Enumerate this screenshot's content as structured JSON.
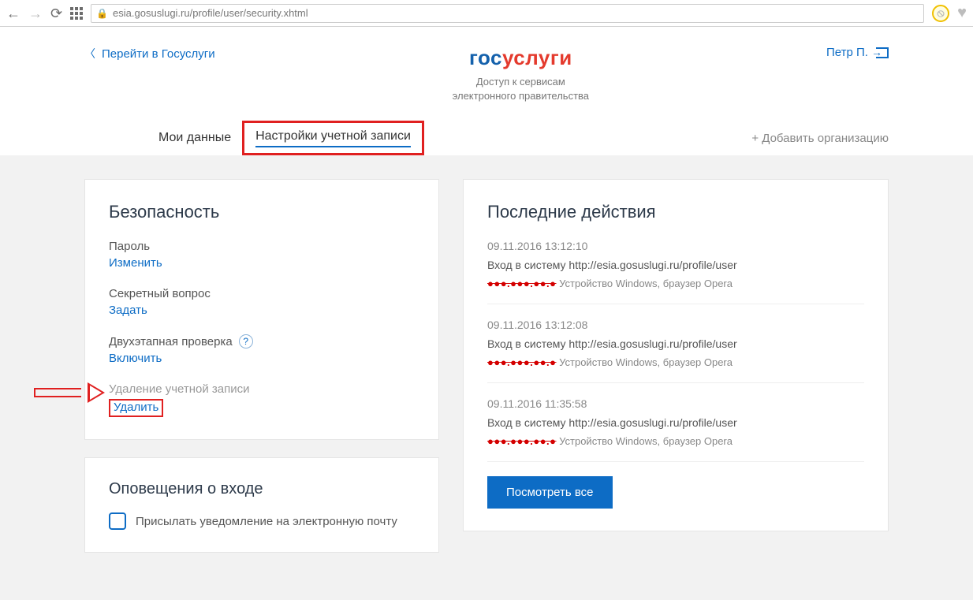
{
  "browser": {
    "url": "esia.gosuslugi.ru/profile/user/security.xhtml"
  },
  "header": {
    "back": "Перейти в Госуслуги",
    "brand_part1": "гос",
    "brand_part2": "услуги",
    "subtitle_l1": "Доступ к сервисам",
    "subtitle_l2": "электронного правительства",
    "user_name": "Петр П."
  },
  "tabs": {
    "t1": "Мои данные",
    "t2": "Настройки учетной записи",
    "add": "Добавить организацию"
  },
  "security": {
    "title": "Безопасность",
    "password_label": "Пароль",
    "password_link": "Изменить",
    "secret_label": "Секретный вопрос",
    "secret_link": "Задать",
    "twofa_label": "Двухэтапная проверка",
    "twofa_link": "Включить",
    "delete_label": "Удаление учетной записи",
    "delete_link": "Удалить"
  },
  "notifications": {
    "title": "Оповещения о входе",
    "email_checkbox": "Присылать уведомление на электронную почту"
  },
  "activity": {
    "title": "Последние действия",
    "button": "Посмотреть все",
    "items": [
      {
        "time": "09.11.2016 13:12:10",
        "desc": "Вход в систему http://esia.gosuslugi.ru/profile/user",
        "ip": "●●●.●●●.●●.●",
        "meta": " Устройство Windows, браузер Opera"
      },
      {
        "time": "09.11.2016 13:12:08",
        "desc": "Вход в систему http://esia.gosuslugi.ru/profile/user",
        "ip": "●●●.●●●.●●.●",
        "meta": " Устройство Windows, браузер Opera"
      },
      {
        "time": "09.11.2016 11:35:58",
        "desc": "Вход в систему http://esia.gosuslugi.ru/profile/user",
        "ip": "●●●.●●●.●●.●",
        "meta": " Устройство Windows, браузер Opera"
      }
    ]
  }
}
